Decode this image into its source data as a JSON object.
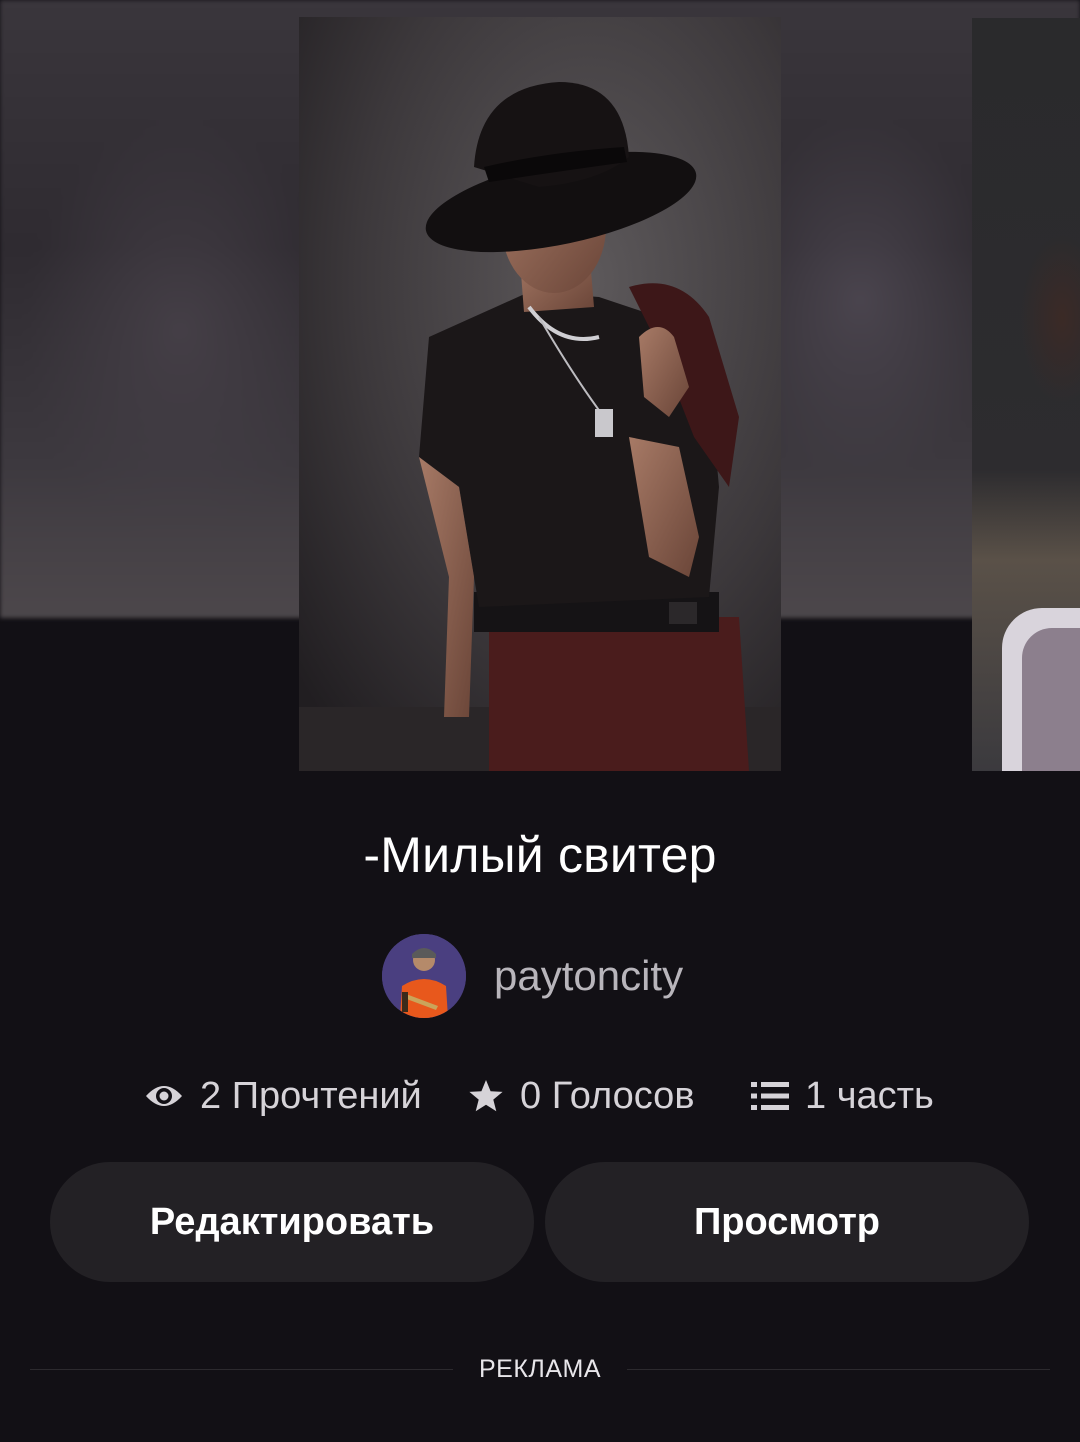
{
  "story": {
    "title": "-Милый свитер",
    "author": "paytoncity"
  },
  "stats": {
    "reads": "2 Прочтений",
    "votes": "0 Голосов",
    "parts": "1 часть"
  },
  "actions": {
    "edit_label": "Редактировать",
    "view_label": "Просмотр"
  },
  "ad": {
    "label": "РЕКЛАМА"
  },
  "icons": {
    "reads": "eye-icon",
    "votes": "star-icon",
    "parts": "list-icon"
  },
  "colors": {
    "background": "#121015",
    "button": "#232125",
    "stat_text": "#d6d3d8",
    "author_text": "#b8b5bb"
  }
}
